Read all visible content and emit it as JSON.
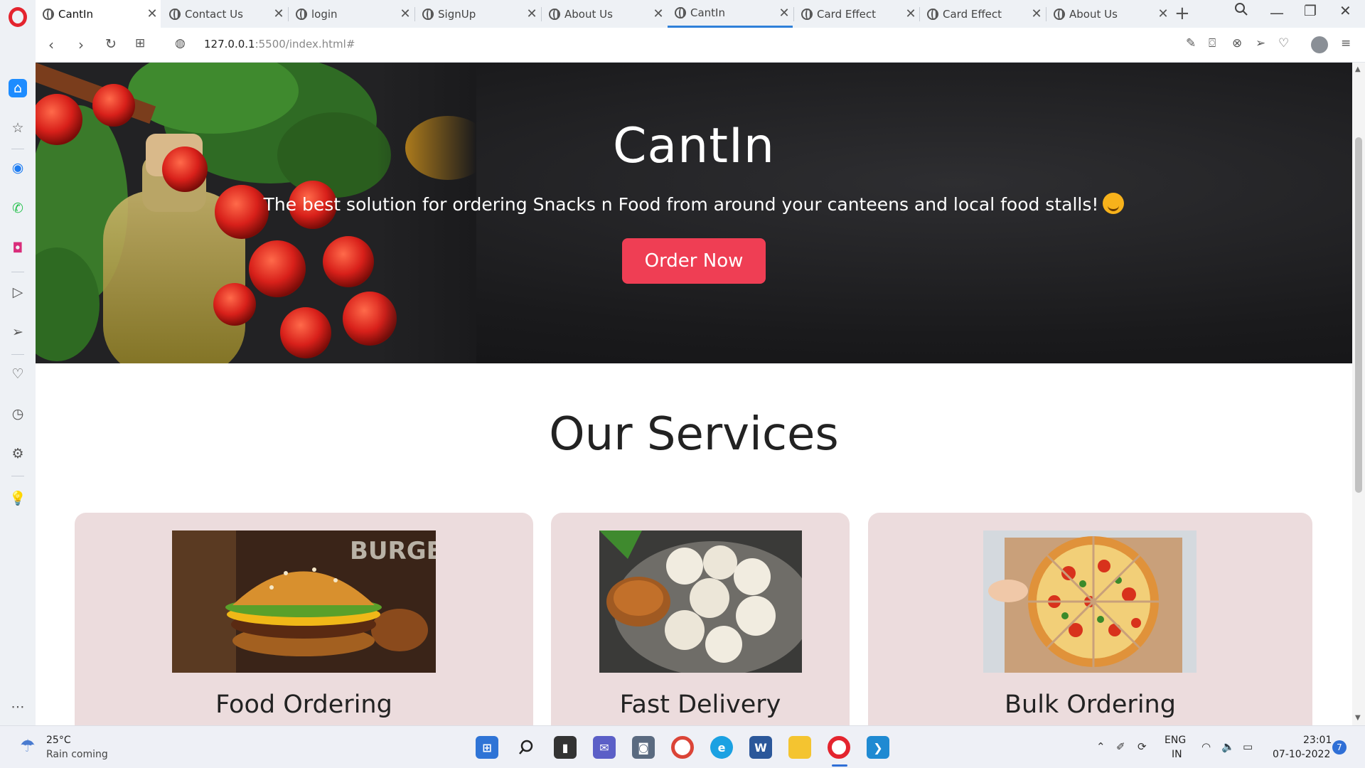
{
  "browser": {
    "tabs": [
      {
        "title": "CantIn",
        "active": true
      },
      {
        "title": "Contact Us"
      },
      {
        "title": "login"
      },
      {
        "title": "SignUp"
      },
      {
        "title": "About Us"
      },
      {
        "title": "CantIn",
        "highlight": true
      },
      {
        "title": "Card Effect"
      },
      {
        "title": "Card Effect"
      },
      {
        "title": "About Us"
      }
    ],
    "url_host": "127.0.0.1",
    "url_path": ":5500/index.html#",
    "icons": {
      "back": "back-arrow-icon",
      "forward": "forward-arrow-icon",
      "reload": "reload-icon",
      "tabs_grid": "grid-icon",
      "site_info": "globe-icon"
    }
  },
  "sidebar": {
    "items": [
      "home-icon",
      "star-icon",
      "messenger-icon",
      "whatsapp-icon",
      "instagram-icon",
      "player-icon",
      "send-icon",
      "heart-icon",
      "history-icon",
      "settings-icon",
      "lightbulb-icon",
      "more-icon"
    ]
  },
  "hero": {
    "title": "CantIn",
    "subtitle": "The best solution for ordering Snacks n Food from around your canteens and local food stalls!",
    "cta": "Order Now"
  },
  "services": {
    "heading": "Our Services",
    "cards": [
      {
        "title": "Food Ordering",
        "image": "burger-image",
        "image_text": "BURGER"
      },
      {
        "title": "Fast Delivery",
        "image": "momos-image"
      },
      {
        "title": "Bulk Ordering",
        "image": "pizza-image"
      }
    ]
  },
  "taskbar": {
    "weather_temp": "25°C",
    "weather_desc": "Rain coming",
    "lang_1": "ENG",
    "lang_2": "IN",
    "time": "23:01",
    "date": "07-10-2022",
    "notifications": "7"
  },
  "colors": {
    "accent": "#ef3e54",
    "card_bg": "#ecdcdd",
    "hero_bg": "#1a1a1c"
  }
}
